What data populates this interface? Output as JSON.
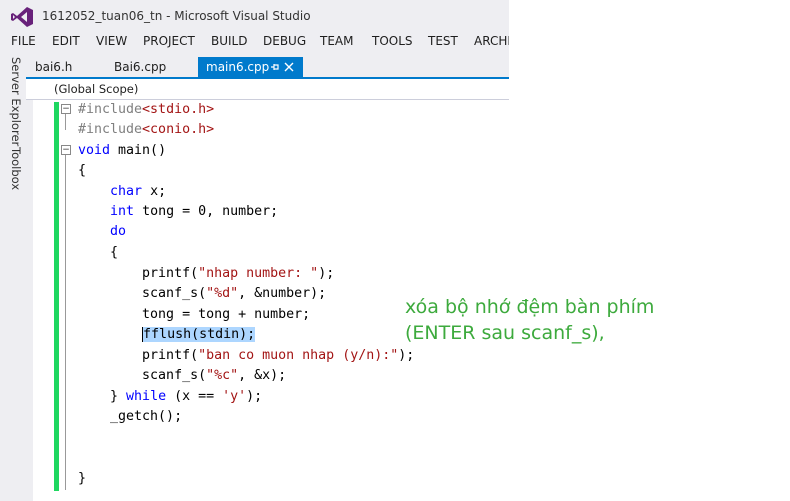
{
  "window": {
    "title": "1612052_tuan06_tn - Microsoft Visual Studio"
  },
  "menu": [
    "FILE",
    "EDIT",
    "VIEW",
    "PROJECT",
    "BUILD",
    "DEBUG",
    "TEAM",
    "TOOLS",
    "TEST",
    "ARCHI"
  ],
  "side_tabs": [
    "Server Explorer",
    "Toolbox"
  ],
  "tabs": [
    {
      "label": "bai6.h",
      "active": false
    },
    {
      "label": "Bai6.cpp",
      "active": false
    },
    {
      "label": "main6.cpp",
      "active": true
    }
  ],
  "tab_icons": {
    "pin": "pin-icon",
    "close": "close-icon"
  },
  "scope": "(Global Scope)",
  "code": {
    "l1": {
      "a": "#include",
      "b": "<stdio.h>"
    },
    "l2": {
      "a": "#include",
      "b": "<conio.h>"
    },
    "l3": {
      "a": "void",
      "b": " main()"
    },
    "l4": "{",
    "l5": {
      "a": "    ",
      "b": "char",
      "c": " x;"
    },
    "l6": {
      "a": "    ",
      "b": "int",
      "c": " tong = 0, number;"
    },
    "l7": {
      "a": "    ",
      "b": "do"
    },
    "l8": "    {",
    "l9": {
      "a": "        printf(",
      "b": "\"nhap number: \"",
      "c": ");"
    },
    "l10": {
      "a": "        scanf_s(",
      "b": "\"%d\"",
      "c": ", &number);"
    },
    "l11": "        tong = tong + number;",
    "l12": {
      "a": "        ",
      "b": "fflush(stdin);"
    },
    "l13": {
      "a": "        printf(",
      "b": "\"ban co muon nhap (y/n):\"",
      "c": ");"
    },
    "l14": {
      "a": "        scanf_s(",
      "b": "\"%c\"",
      "c": ", &x);"
    },
    "l15": {
      "a": "    } ",
      "b": "while",
      "c": " (x == ",
      "d": "'y'",
      "e": ");"
    },
    "l16": "    _getch();",
    "l17": "",
    "l18": "",
    "l19": "}"
  },
  "annotation": {
    "line1": "xóa bộ nhớ đệm bàn phím",
    "line2": "(ENTER sau scanf_s),"
  },
  "colors": {
    "accent": "#007acc",
    "keyword": "#0000ff",
    "string": "#a31515",
    "preprocessor": "#808080",
    "change_bar": "#1ed760",
    "annotation": "#3daa3d",
    "selection": "#add6ff"
  }
}
